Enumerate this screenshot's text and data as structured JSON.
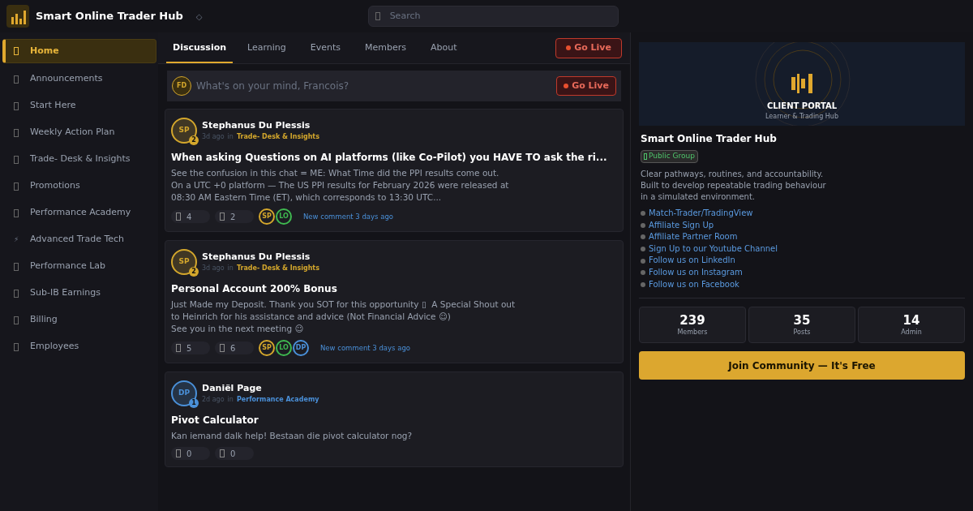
{
  "header": {
    "title": "Smart Online Trader Hub",
    "caret": "◇",
    "search": {
      "placeholder": "Search"
    }
  },
  "sidebar": {
    "items": [
      {
        "label": "Home",
        "selected": true
      },
      {
        "label": "Announcements",
        "selected": false
      },
      {
        "label": "Start Here",
        "selected": false
      },
      {
        "label": "Weekly Action Plan",
        "selected": false
      },
      {
        "label": "Trade- Desk & Insights",
        "selected": false
      },
      {
        "label": "Promotions",
        "selected": false
      },
      {
        "label": "Performance Academy",
        "selected": false
      },
      {
        "label": "Advanced Trade Tech",
        "selected": false,
        "glyph": "⚡"
      },
      {
        "label": "Performance Lab",
        "selected": false
      },
      {
        "label": "Sub-IB Earnings",
        "selected": false
      },
      {
        "label": "Billing",
        "selected": false
      },
      {
        "label": "Employees",
        "selected": false
      }
    ]
  },
  "tabs": [
    {
      "label": "Discussion",
      "selected": true
    },
    {
      "label": "Learning",
      "selected": false
    },
    {
      "label": "Events",
      "selected": false
    },
    {
      "label": "Members",
      "selected": false
    },
    {
      "label": "About",
      "selected": false
    }
  ],
  "go_live": "Go Live",
  "composer": {
    "avatar": "FD",
    "placeholder": "What's on your mind, Francois?",
    "button": "Go Live"
  },
  "posts": [
    {
      "avatar": "SP",
      "color": "#d4a72c",
      "badge": "2",
      "author": "Stephanus Du Plessis",
      "time": "3d ago",
      "in": "in",
      "category": "Trade- Desk & Insights",
      "title": "When asking Questions on AI platforms (like Co-Pilot) you HAVE TO ask the ri...",
      "body": [
        "See the confusion in this chat = ME: What Time did the PPI results come out.",
        "On a UTC +0 platform — The US PPI results for February 2026 were released at",
        "08:30 AM Eastern Time (ET), which corresponds to 13:30 UTC..."
      ],
      "likes": "4",
      "comments": "2",
      "participants": [
        {
          "initials": "SP",
          "color": "#d4a72c"
        },
        {
          "initials": "LO",
          "color": "#3fb950"
        }
      ],
      "activity": "New comment 3 days ago"
    },
    {
      "avatar": "SP",
      "color": "#d4a72c",
      "badge": "2",
      "author": "Stephanus Du Plessis",
      "time": "3d ago",
      "in": "in",
      "category": "Trade- Desk & Insights",
      "title": "Personal Account 200% Bonus",
      "body": [
        "Just Made my Deposit. Thank you SOT for this opportunity ▯  A Special Shout out",
        "to Heinrich for his assistance and advice (Not Financial Advice ☺)",
        "See you in the next meeting ☺"
      ],
      "likes": "5",
      "comments": "6",
      "participants": [
        {
          "initials": "SP",
          "color": "#d4a72c"
        },
        {
          "initials": "LO",
          "color": "#3fb950"
        },
        {
          "initials": "DP",
          "color": "#4a90d9"
        }
      ],
      "activity": "New comment 3 days ago"
    },
    {
      "avatar": "DP",
      "color": "#4a90d9",
      "badge": "1",
      "author": "Daniël Page",
      "time": "2d ago",
      "in": "in",
      "category": "Performance Academy",
      "title": "Pivot Calculator",
      "body": [
        "Kan iemand dalk help! Bestaan die pivot calculator nog?"
      ],
      "likes": "0",
      "comments": "0"
    }
  ],
  "about": {
    "banner_title": "CLIENT PORTAL",
    "banner_subtitle": "Learner & Trading Hub",
    "name": "Smart Online Trader Hub",
    "badge": "Public Group",
    "description": [
      "Clear pathways, routines, and accountability.",
      "Built to develop repeatable trading behaviour",
      "in a simulated environment."
    ],
    "links": [
      "Match-Trader/TradingView",
      "Affiliate Sign Up",
      "Affiliate Partner Room",
      "Sign Up to our Youtube Channel",
      "Follow us on LinkedIn",
      "Follow us on Instagram",
      "Follow us on Facebook"
    ],
    "stats": [
      {
        "value": "239",
        "label": "Members"
      },
      {
        "value": "35",
        "label": "Posts"
      },
      {
        "value": "14",
        "label": "Admin"
      }
    ],
    "join": "Join Community — It's Free"
  }
}
